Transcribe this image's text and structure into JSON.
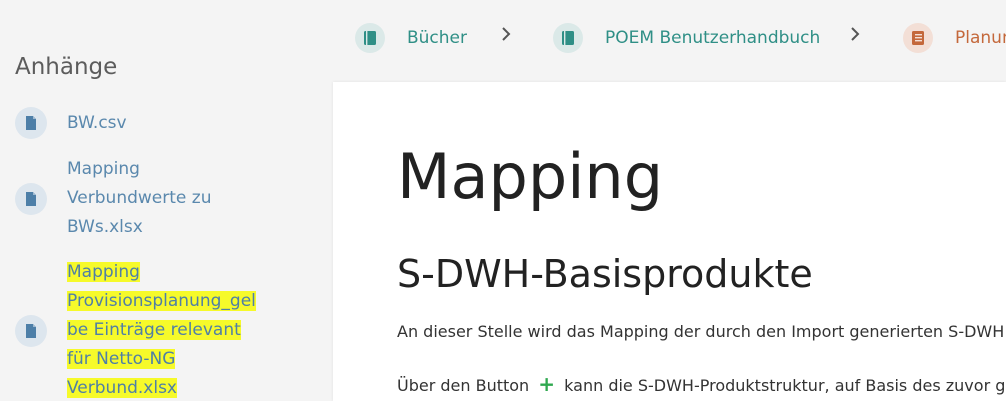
{
  "breadcrumb": {
    "items": [
      {
        "label": "Bücher",
        "icon": "book-icon"
      },
      {
        "label": "POEM Benutzerhandbuch",
        "icon": "book-icon"
      },
      {
        "label": "Planun",
        "icon": "chapter-icon"
      }
    ],
    "separator_icon": "chevron-right-icon"
  },
  "sidebar": {
    "title": "Anhänge",
    "attachments": [
      {
        "name": "BW.csv",
        "highlighted": false,
        "icon": "file-icon"
      },
      {
        "name": "Mapping Verbundwerte zu BWs.xlsx",
        "highlighted": false,
        "icon": "file-icon"
      },
      {
        "name": "Mapping Provisionsplanung_gelbe Einträge relevant für Netto-NG Verbund.xlsx",
        "highlighted": true,
        "icon": "file-icon"
      }
    ],
    "lines": {
      "a1": "BW.csv",
      "a2_1": "Mapping",
      "a2_2": "Verbundwerte zu",
      "a2_3": "BWs.xlsx",
      "a3_1": "Mapping",
      "a3_2": "Provisionsplanung_gel",
      "a3_3": "be Einträge relevant",
      "a3_4": "für Netto-NG",
      "a3_5": "Verbund.xlsx"
    }
  },
  "main": {
    "title": "Mapping",
    "section": "S-DWH-Basisprodukte",
    "para1": "An dieser Stelle wird das Mapping der durch den Import generierten S-DWH",
    "para2_before": "Über den Button",
    "para2_icon": "+",
    "para2_after": "kann die S-DWH-Produktstruktur, auf Basis des zuvor ge"
  },
  "colors": {
    "teal": "#2f8f86",
    "orange": "#c4683b",
    "link": "#5a88ad",
    "highlight": "#f6fa2a",
    "plus": "#2fa84f"
  }
}
